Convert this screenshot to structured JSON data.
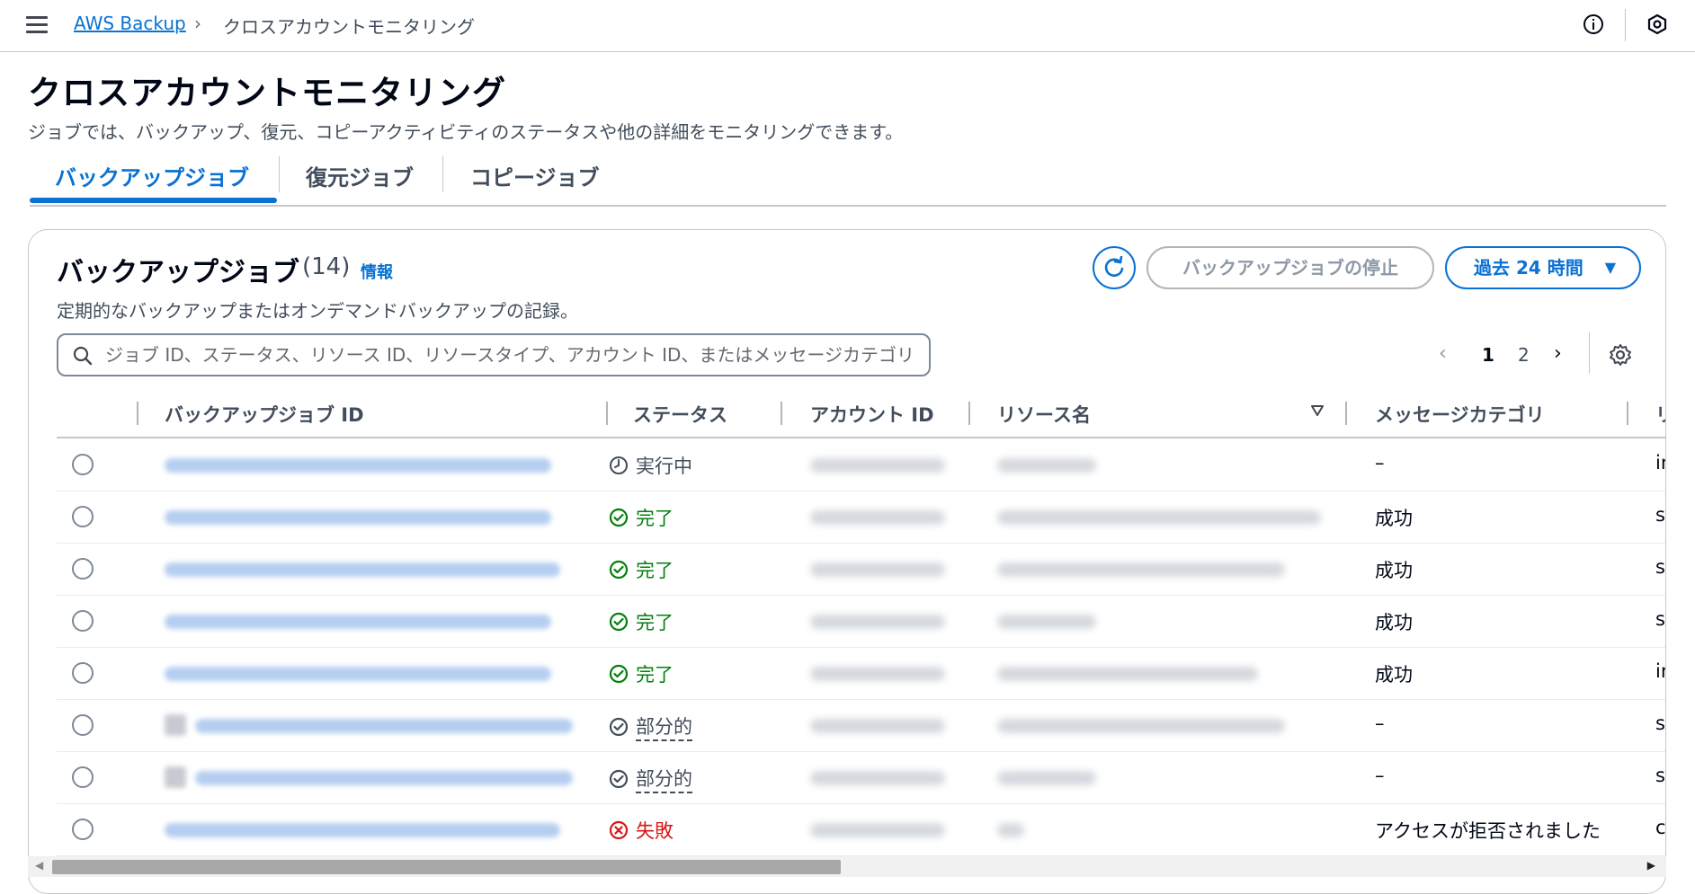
{
  "breadcrumb": {
    "root": "AWS Backup",
    "separator": "›",
    "current": "クロスアカウントモニタリング"
  },
  "header": {
    "title": "クロスアカウントモニタリング",
    "description": "ジョブでは、バックアップ、復元、コピーアクティビティのステータスや他の詳細をモニタリングできます。"
  },
  "tabs": [
    {
      "label": "バックアップジョブ",
      "active": true
    },
    {
      "label": "復元ジョブ",
      "active": false
    },
    {
      "label": "コピージョブ",
      "active": false
    }
  ],
  "panel": {
    "title": "バックアップジョブ",
    "count": "(14)",
    "info_link": "情報",
    "description": "定期的なバックアップまたはオンデマンドバックアップの記録。",
    "stop_button": "バックアップジョブの停止",
    "range_button": "過去 24 時間",
    "range_caret": "▼"
  },
  "search": {
    "placeholder": "ジョブ ID、ステータス、リソース ID、リソースタイプ、アカウント ID、またはメッセージカテゴリ"
  },
  "pagination": {
    "prev": "‹",
    "pages": [
      "1",
      "2"
    ],
    "current": "1",
    "next": "›"
  },
  "table": {
    "columns": [
      "バックアップジョブ ID",
      "ステータス",
      "アカウント ID",
      "リソース名",
      "メッセージカテゴリ",
      "リソ"
    ],
    "rows": [
      {
        "status": "実行中",
        "status_kind": "running",
        "message": "–",
        "resource_type": "insta"
      },
      {
        "status": "完了",
        "status_kind": "done",
        "message": "成功",
        "resource_type": "stack"
      },
      {
        "status": "完了",
        "status_kind": "done",
        "message": "成功",
        "resource_type": "stack"
      },
      {
        "status": "完了",
        "status_kind": "done",
        "message": "成功",
        "resource_type": "stack"
      },
      {
        "status": "完了",
        "status_kind": "done",
        "message": "成功",
        "resource_type": "insta"
      },
      {
        "status": "部分的",
        "status_kind": "partial",
        "message": "–",
        "resource_type": "stack"
      },
      {
        "status": "部分的",
        "status_kind": "partial",
        "message": "–",
        "resource_type": "stack"
      },
      {
        "status": "失敗",
        "status_kind": "fail",
        "message": "アクセスが拒否されました",
        "resource_type": "cdk-l"
      }
    ]
  },
  "colors": {
    "accent": "#0972d3",
    "success": "#037f0c",
    "error": "#d91515",
    "text": "#000716",
    "muted": "#414d5c"
  },
  "icons": [
    "menu-icon",
    "info-icon",
    "settings-hex-icon",
    "refresh-icon",
    "search-icon",
    "settings-icon",
    "sort-desc-icon",
    "clock-icon",
    "check-circle-icon",
    "partial-check-icon",
    "error-circle-icon"
  ]
}
